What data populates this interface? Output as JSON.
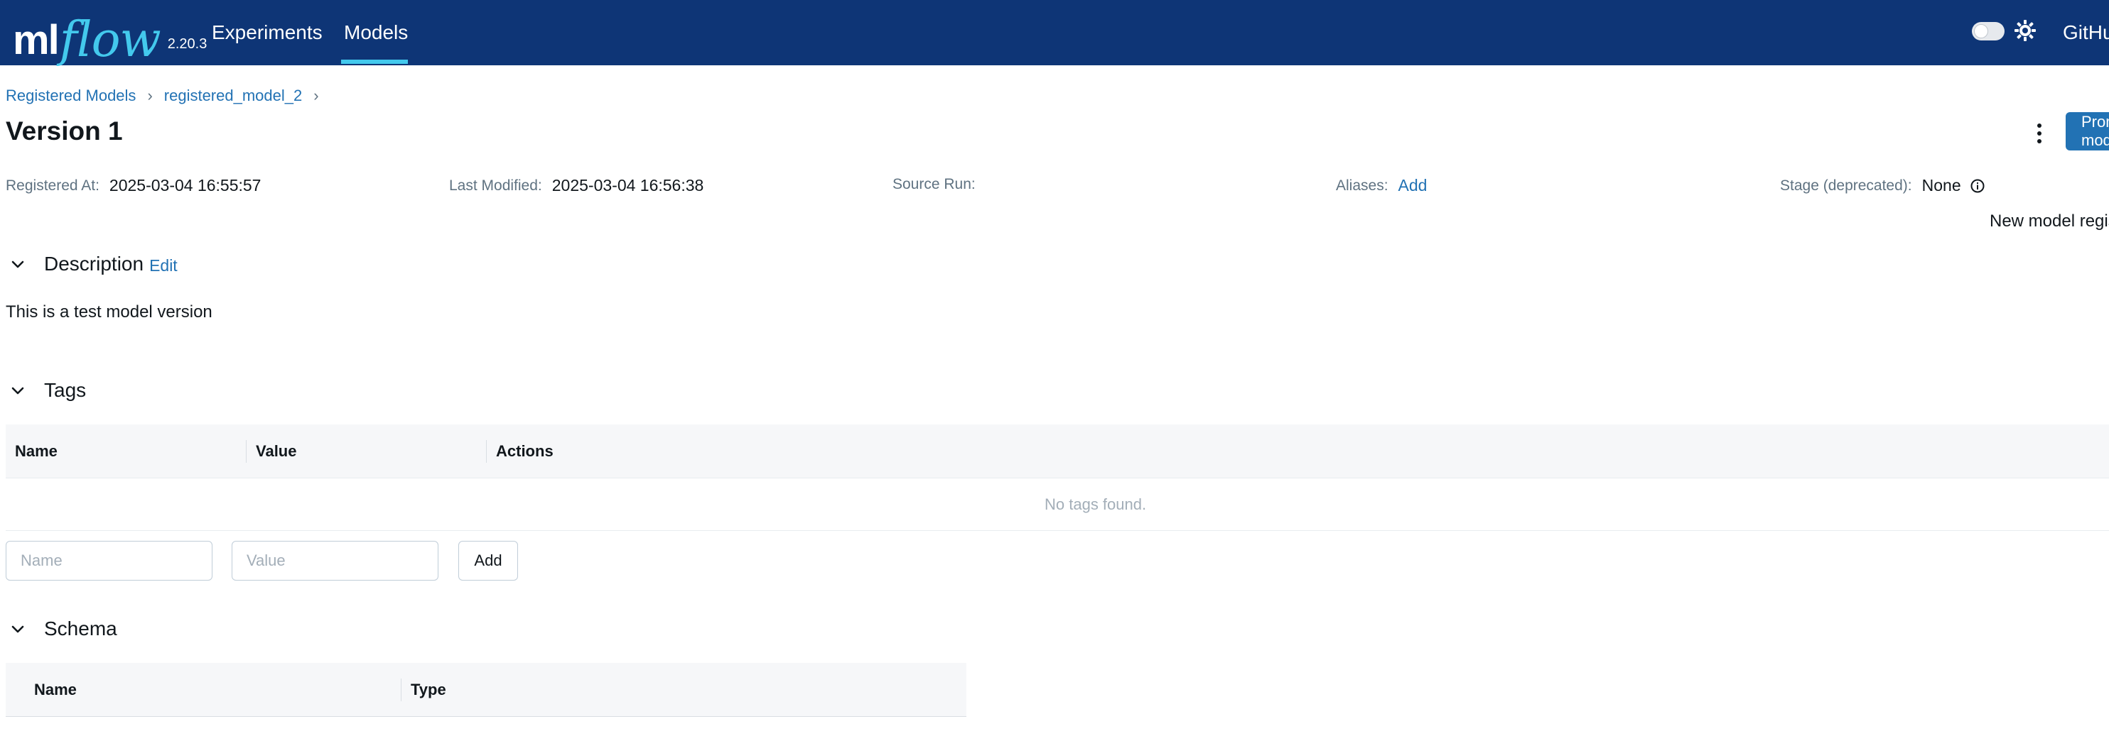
{
  "nav": {
    "logo_ml": "ml",
    "logo_flow": "flow",
    "version": "2.20.3",
    "experiments": "Experiments",
    "models": "Models",
    "github": "GitHub"
  },
  "breadcrumb": {
    "root": "Registered Models",
    "sep1": "›",
    "model": "registered_model_2",
    "sep2": "›"
  },
  "page": {
    "title": "Version 1",
    "promote_button": "Promote model"
  },
  "metadata": {
    "registered_label": "Registered At:",
    "registered_value": "2025-03-04 16:55:57",
    "modified_label": "Last Modified:",
    "modified_value": "2025-03-04 16:56:38",
    "source_label": "Source Run:",
    "source_value": "",
    "aliases_label": "Aliases:",
    "aliases_add": "Add",
    "stage_label": "Stage (deprecated):",
    "stage_value": "None",
    "description_label": "New model registry UI"
  },
  "description": {
    "title": "Description",
    "edit": "Edit",
    "text": "This is a test model version"
  },
  "tags": {
    "title": "Tags",
    "columns": [
      "Name",
      "Value",
      "Actions"
    ],
    "empty": "No tags found.",
    "name_placeholder": "Name",
    "value_placeholder": "Value",
    "add_button": "Add"
  },
  "schema": {
    "title": "Schema",
    "columns": [
      "Name",
      "Type"
    ]
  },
  "colors": {
    "navbar": "#0e3576",
    "accent": "#43c9ed",
    "link": "#2272b4",
    "primary_button": "#2272b4"
  }
}
